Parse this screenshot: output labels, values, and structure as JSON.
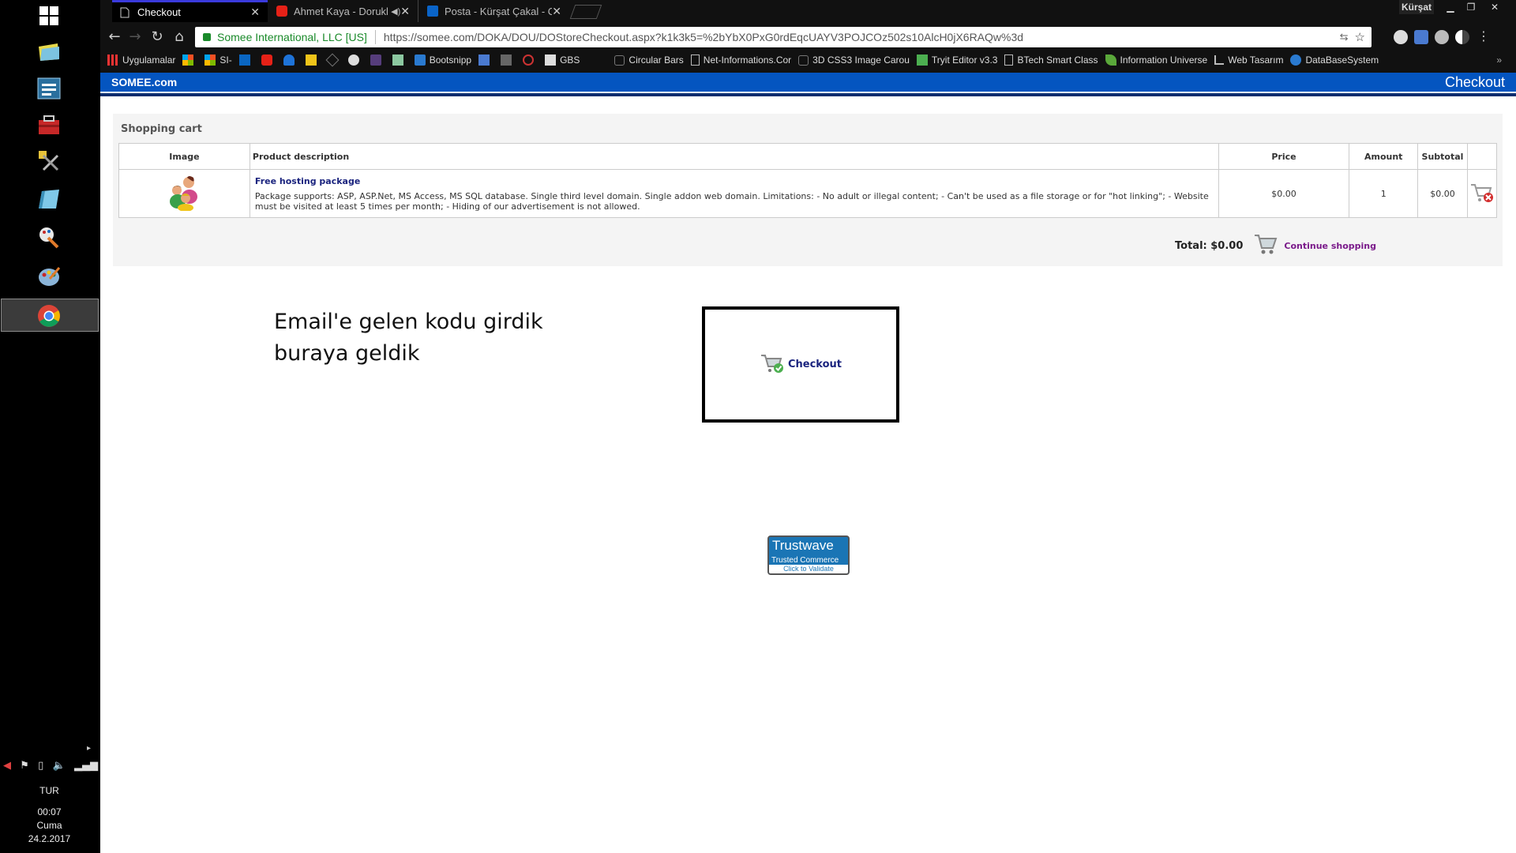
{
  "taskbar": {
    "language": "TUR",
    "time": "00:07",
    "day": "Cuma",
    "date": "24.2.2017"
  },
  "tabs": [
    {
      "label": "Checkout",
      "active": true
    },
    {
      "label": "Ahmet Kaya - Dorukl",
      "active": false
    },
    {
      "label": "Posta - Kürşat Çakal - O",
      "active": false
    }
  ],
  "window": {
    "user": "Kürşat"
  },
  "toolbar": {
    "secure_label": "Somee International, LLC [US]",
    "url": "https://somee.com/DOKA/DOU/DOStoreCheckout.aspx?k1k3k5=%2bYbX0PxG0rdEqcUAYV3POJCOz502s10AlcH0jX6RAQw%3d"
  },
  "bookmarks": [
    {
      "label": "Uygulamalar"
    },
    {
      "label": ""
    },
    {
      "label": "SI-"
    },
    {
      "label": ""
    },
    {
      "label": ""
    },
    {
      "label": ""
    },
    {
      "label": ""
    },
    {
      "label": ""
    },
    {
      "label": ""
    },
    {
      "label": ""
    },
    {
      "label": ""
    },
    {
      "label": "Bootsnipp"
    },
    {
      "label": ""
    },
    {
      "label": ""
    },
    {
      "label": ""
    },
    {
      "label": "GBS"
    },
    {
      "label": "Circular Bars"
    },
    {
      "label": "Net-Informations.Cor"
    },
    {
      "label": "3D CSS3 Image Carou"
    },
    {
      "label": "Tryit Editor v3.3"
    },
    {
      "label": "BTech Smart Class"
    },
    {
      "label": "Information Universe"
    },
    {
      "label": "Web Tasarım"
    },
    {
      "label": "DataBaseSystem"
    }
  ],
  "site": {
    "logo": "SOMEE.com",
    "page_title": "Checkout"
  },
  "cart": {
    "title": "Shopping cart",
    "columns": {
      "image": "Image",
      "description": "Product description",
      "price": "Price",
      "amount": "Amount",
      "subtotal": "Subtotal"
    },
    "row": {
      "name": "Free hosting package",
      "description": "Package supports: ASP, ASP.Net, MS Access, MS SQL database. Single third level domain. Single addon web domain. Limitations: - No adult or illegal content; - Can't be used as a file storage or for \"hot linking\"; - Website must be visited at least 5 times per month; - Hiding of our advertisement is not allowed.",
      "price": "$0.00",
      "amount": "1",
      "subtotal": "$0.00"
    },
    "total": "Total: $0.00",
    "continue_label": "Continue shopping"
  },
  "note": {
    "line1": "Email'e gelen kodu girdik",
    "line2": "buraya geldik"
  },
  "checkout_button": "Checkout",
  "trustwave": {
    "brand": "Trustwave",
    "sub": "Trusted Commerce",
    "validate": "Click to Validate"
  },
  "colors": {
    "header_blue": "#0455c0",
    "link_blue": "#1a237e",
    "continue_purple": "#7a1a8a",
    "secure_green": "#1a8a2a"
  }
}
